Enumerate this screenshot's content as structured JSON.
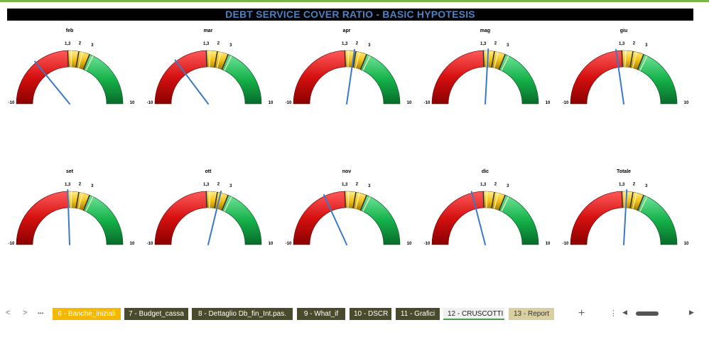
{
  "title": "DEBT SERVICE COVER RATIO - BASIC  HYPOTESIS",
  "scale": {
    "min_label": "-10",
    "max_label": "10",
    "thresholds": [
      "1,3",
      "2",
      "3"
    ]
  },
  "colors": {
    "red": "#d51010",
    "yellow": "#f3c21a",
    "green": "#16b24a",
    "needle": "#3a78c8",
    "tab_dark": "#4a4a2c",
    "tab_yellow": "#f5b800"
  },
  "gauges": [
    {
      "label": "feb",
      "value": -3.5
    },
    {
      "label": "mar",
      "value": -3.2
    },
    {
      "label": "apr",
      "value": 1.9
    },
    {
      "label": "mag",
      "value": 1.6
    },
    {
      "label": "giu",
      "value": 0.5
    },
    {
      "label": "set",
      "value": 1.3
    },
    {
      "label": "ott",
      "value": 2.3
    },
    {
      "label": "nov",
      "value": -1.6
    },
    {
      "label": "dic",
      "value": -0.3
    },
    {
      "label": "Totale",
      "value": 1.6
    }
  ],
  "tabbar": {
    "nav_prev": "<",
    "nav_next": ">",
    "nav_more": "•••",
    "tabs": [
      {
        "label": "6 - Banche_iniziali",
        "style": "yellow"
      },
      {
        "label": "7 - Budget_cassa",
        "style": "dark"
      },
      {
        "label": "8 - Dettaglio Db_fin_Int.pas.",
        "style": "dark"
      },
      {
        "label": "9 - What_if",
        "style": "dark"
      },
      {
        "label": "10 - DSCR",
        "style": "dark"
      },
      {
        "label": "11 - Grafici",
        "style": "dark"
      },
      {
        "label": "12 - CRUSCOTTI",
        "style": "active"
      },
      {
        "label": "13 - Report",
        "style": "report"
      }
    ],
    "add": "+",
    "scroll_dots": "⋮",
    "scroll_left": "◀",
    "scroll_right": "▶"
  }
}
